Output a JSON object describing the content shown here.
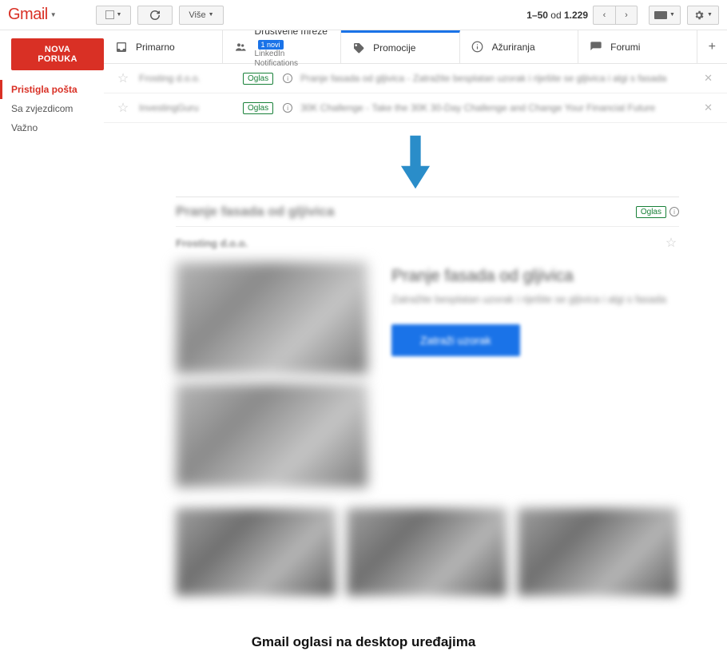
{
  "header": {
    "logo": "Gmail",
    "more_label": "Više"
  },
  "pager": {
    "range_start": "1",
    "range_end": "50",
    "of_label": "od",
    "total": "1.229"
  },
  "sidebar": {
    "compose": "NOVA PORUKA",
    "items": [
      {
        "label": "Pristigla pošta"
      },
      {
        "label": "Sa zvjezdicom"
      },
      {
        "label": "Važno"
      }
    ]
  },
  "tabs": [
    {
      "label": "Primarno",
      "sub": ""
    },
    {
      "label": "Društvene mreže",
      "sub": "LinkedIn Notifications",
      "badge": "1 novi"
    },
    {
      "label": "Promocije",
      "sub": ""
    },
    {
      "label": "Ažuriranja",
      "sub": ""
    },
    {
      "label": "Forumi",
      "sub": ""
    }
  ],
  "oglas_tag": "Oglas",
  "emails": [
    {
      "sender": "Frosting d.o.o.",
      "subject": "Pranje fasada od gljivica - Zatražite besplatan uzorak i riješite se gljivica i algi s fasada"
    },
    {
      "sender": "InvestingGuru",
      "subject": "30K Challenge - Take the 30K 30-Day Challenge and Change Your Financial Future"
    }
  ],
  "detail": {
    "title": "Pranje fasada od gljivica",
    "sender": "Frosting d.o.o.",
    "ad_title": "Pranje fasada od gljivica",
    "ad_desc": "Zatražite besplatan uzorak i riješite se gljivica i algi s fasada",
    "cta": "Zatraži uzorak"
  },
  "caption": "Gmail oglasi na desktop uređajima",
  "colors": {
    "accent_red": "#d93025",
    "accent_blue": "#1a73e8",
    "oglas_green": "#188038"
  }
}
